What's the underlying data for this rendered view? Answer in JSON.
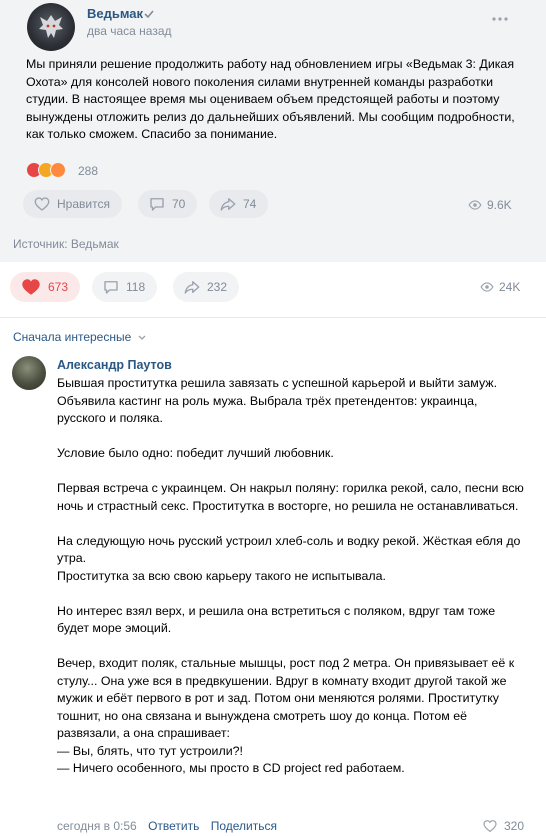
{
  "repost": {
    "author": "Ведьмак",
    "time": "два часа назад",
    "text": "Мы приняли решение продолжить работу над обновлением игры «Ведьмак 3: Дикая Охота» для консолей нового поколения силами внутренней команды разработки студии. В настоящее время мы оцениваем объем предстоящей работы и поэтому вынуждены отложить релиз до дальнейших объявлений. Мы сообщим подробности, как только сможем. Спасибо за понимание.",
    "reactions_count": "288",
    "like_label": "Нравится",
    "comments": "70",
    "shares": "74",
    "views": "9.6K",
    "icons": [
      "verified-icon",
      "more-icon",
      "heart-icon",
      "comment-icon",
      "share-icon",
      "eye-icon"
    ]
  },
  "source": "Источник: Ведьмак",
  "post_actions": {
    "likes": "673",
    "comments": "118",
    "shares": "232",
    "views": "24K",
    "accent": "#e64646"
  },
  "comments_header": {
    "sort_label": "Сначала интересные"
  },
  "comment": {
    "author": "Александр Паутов",
    "paragraphs": [
      "Бывшая проститутка решила завязать с успешной карьерой и выйти замуж.\nОбъявила кастинг на роль мужа. Выбрала трёх претендентов: украинца, русского и поляка.",
      "Условие было одно: победит лучший любовник.",
      "Первая встреча с украинцем. Он накрыл поляну: горилка рекой, сало, песни всю ночь и страстный секс. Проститутка в восторге, но решила не останавливаться.",
      "На следующую ночь русский устроил хлеб-соль и водку рекой. Жёсткая ебля до утра.\nПроститутка за всю свою карьеру такого не испытывала.",
      "Но интерес взял верх, и решила она встретиться с поляком, вдруг там тоже будет море эмоций.",
      "Вечер, входит поляк, стальные мышцы, рост под 2 метра. Он привязывает её к стулу... Она уже вся в предвкушении. Вдруг в комнату входит другой такой же мужик и ебёт первого в рот и зад. Потом они меняются ролями. Проститутку тошнит, но она связана и вынуждена смотреть шоу до конца. Потом её развязали, а она спрашивает:\n— Вы, блять, что тут устроили?!\n— Ничего особенного, мы просто в CD project red работаем."
    ],
    "time": "сегодня в 0:56",
    "reply_label": "Ответить",
    "share_label": "Поделиться",
    "likes": "320"
  }
}
